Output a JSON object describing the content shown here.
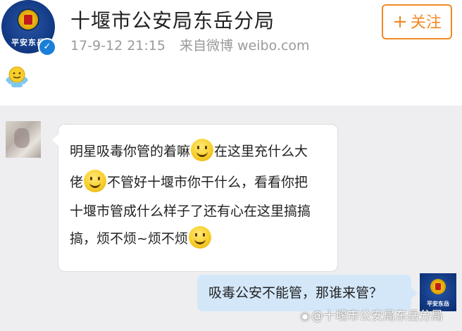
{
  "post_header": {
    "account_name": "十堰市公安局东岳分局",
    "avatar_text": "平安东岳",
    "verified_badge": "✓",
    "timestamp": "17-9-12 21:15",
    "source": "来自微博 weibo.com",
    "follow_label": "关注",
    "follow_icon": "+"
  },
  "post_body": {
    "emoji": "shrug-emoji"
  },
  "chat": {
    "incoming_message": {
      "lines": [
        {
          "a": "明星吸毒你管的着嘛",
          "b": "在这里充什么大"
        },
        {
          "a": "佬",
          "b": "不管好十堰市你干什么，看看你把"
        },
        {
          "a": "十堰市管成什么样子了还有心在这里搞搞"
        },
        {
          "a": "搞，烦不烦~烦不烦"
        }
      ]
    },
    "reply_message": "吸毒公安不能管，那谁来管？",
    "reply_avatar_text": "平安东岳"
  },
  "watermark": {
    "icon": "weibo-logo",
    "text": "@十堰市公安局东岳分局"
  },
  "colors": {
    "accent_orange": "#f08a24",
    "verified_blue": "#1a7fd8",
    "reply_bubble": "#d3e7f8",
    "chat_background": "#eeeef1"
  }
}
